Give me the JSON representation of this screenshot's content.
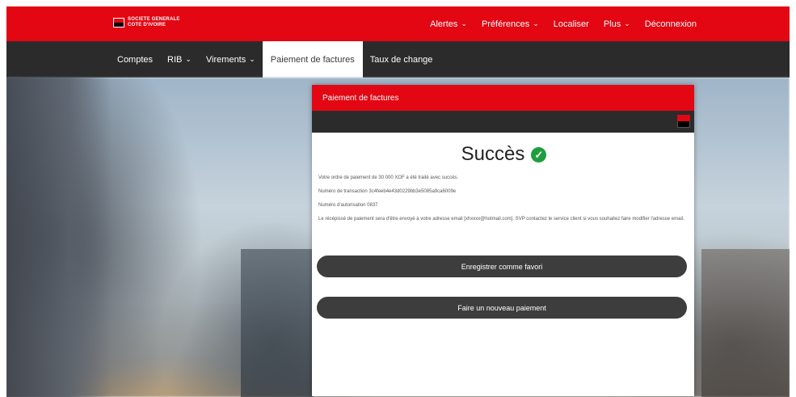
{
  "brand": {
    "line1": "SOCIETE GENERALE",
    "line2": "COTE D'IVOIRE"
  },
  "topnav": [
    {
      "label": "Alertes",
      "dropdown": true
    },
    {
      "label": "Préférences",
      "dropdown": true
    },
    {
      "label": "Localiser",
      "dropdown": false
    },
    {
      "label": "Plus",
      "dropdown": true
    },
    {
      "label": "Déconnexion",
      "dropdown": false
    }
  ],
  "tabs": [
    {
      "label": "Comptes",
      "dropdown": false,
      "active": false
    },
    {
      "label": "RIB",
      "dropdown": true,
      "active": false
    },
    {
      "label": "Virements",
      "dropdown": true,
      "active": false
    },
    {
      "label": "Paiement de factures",
      "dropdown": false,
      "active": true
    },
    {
      "label": "Taux de change",
      "dropdown": false,
      "active": false
    }
  ],
  "modal": {
    "header": "Paiement de factures",
    "title": "Succès",
    "messages": [
      "Votre ordre de paiement de 30 000 XOF a été traité avec succès.",
      "Numéro de transaction 3c4feeb4e43d0229bb3e5085a9ca6009e",
      "Numéro d'autorisation 0837",
      "Le récépissé de paiement sera d'être envoyé à votre adresse email [xhxxxx@hotmail.com]. SVP contactez le service client si vous souhaitez faire modifier l'adresse email."
    ],
    "save_button": "Enregistrer comme favori",
    "new_button": "Faire un nouveau paiement"
  },
  "colors": {
    "brand_red": "#e30613",
    "dark_bar": "#2b2b2b",
    "button_dark": "#3d3d3d",
    "success_green": "#1f9e3d"
  },
  "icons": {
    "success": "check-circle-icon",
    "dropdown": "chevron-down-icon"
  }
}
